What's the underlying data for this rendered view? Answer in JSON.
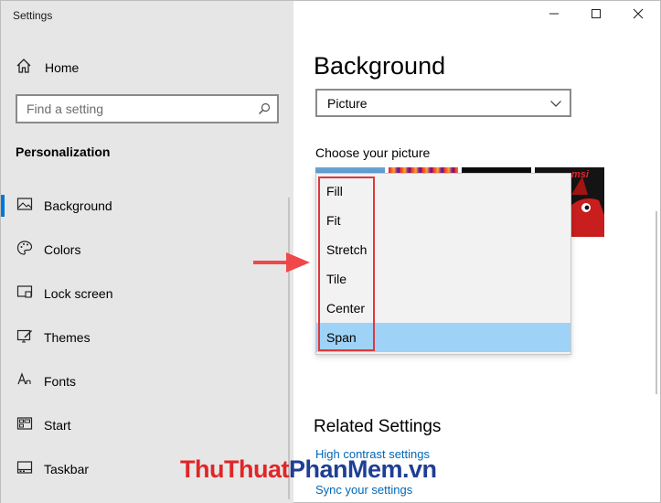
{
  "window": {
    "title": "Settings",
    "controls": {
      "minimize": "minimize-icon",
      "maximize": "maximize-icon",
      "close": "close-icon"
    }
  },
  "sidebar": {
    "home_label": "Home",
    "search_placeholder": "Find a setting",
    "section_title": "Personalization",
    "items": [
      {
        "label": "Background",
        "icon": "picture-icon",
        "active": true
      },
      {
        "label": "Colors",
        "icon": "palette-icon"
      },
      {
        "label": "Lock screen",
        "icon": "lock-screen-icon"
      },
      {
        "label": "Themes",
        "icon": "themes-icon"
      },
      {
        "label": "Fonts",
        "icon": "fonts-icon"
      },
      {
        "label": "Start",
        "icon": "start-icon"
      },
      {
        "label": "Taskbar",
        "icon": "taskbar-icon"
      }
    ]
  },
  "main": {
    "page_title": "Background",
    "background_select": {
      "value": "Picture"
    },
    "choose_picture_label": "Choose your picture",
    "fit_dropdown": {
      "options": [
        "Fill",
        "Fit",
        "Stretch",
        "Tile",
        "Center",
        "Span"
      ],
      "selected": "Span"
    },
    "thumbnail_badge": "msi",
    "related": {
      "title": "Related Settings",
      "links": [
        "High contrast settings",
        "Sync your settings"
      ]
    }
  },
  "watermark": {
    "part1": "ThuThuat",
    "part2": "PhanMem",
    "part3": ".vn"
  },
  "colors": {
    "accent": "#0078d7",
    "link": "#0067b8",
    "selected_option": "#9fd2f7",
    "annotation_red": "#e0373b",
    "watermark_red": "#e02626",
    "watermark_blue": "#1e3f94"
  }
}
